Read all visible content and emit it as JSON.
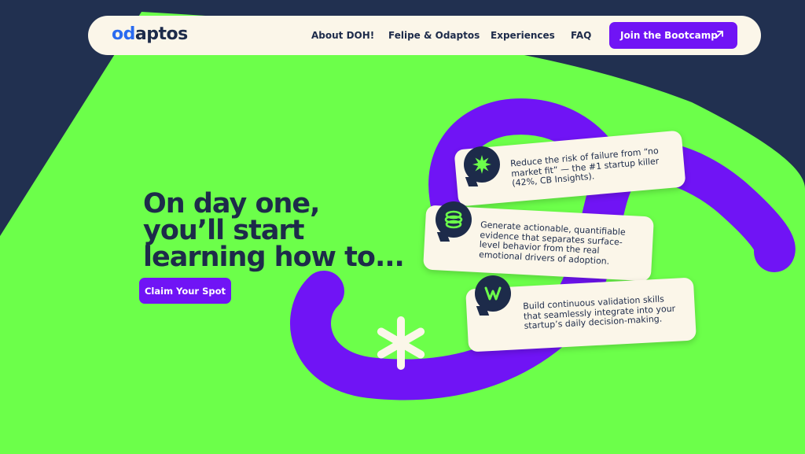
{
  "logo": {
    "part1": "od",
    "part2": "aptos"
  },
  "nav": {
    "links": [
      "About DOH!",
      "Felipe & Odaptos",
      "Experiences",
      "FAQ"
    ],
    "cta_label": "Join the Bootcamp",
    "cta_icon": "arrow-up-right-icon"
  },
  "hero": {
    "headline_lines": [
      "On day one,",
      "you’ll start",
      "learning how to..."
    ],
    "cta_label": "Claim Your Spot"
  },
  "cards": [
    {
      "icon": "starburst-icon",
      "text": "Reduce the risk of failure from “no market fit” — the #1 startup killer (42%, CB Insights)."
    },
    {
      "icon": "spiral-icon",
      "text": "Generate actionable, quantifiable evidence that separates surface-level behavior from the real emotional drivers of adoption."
    },
    {
      "icon": "w-letter-icon",
      "text": "Build continuous validation skills that seamlessly integrate into your startup’s daily decision-making."
    }
  ],
  "colors": {
    "navy": "#213050",
    "green": "#6cff4a",
    "purple": "#7014f5",
    "cream": "#fbf6e9",
    "logo_blue": "#2a6bf0"
  }
}
